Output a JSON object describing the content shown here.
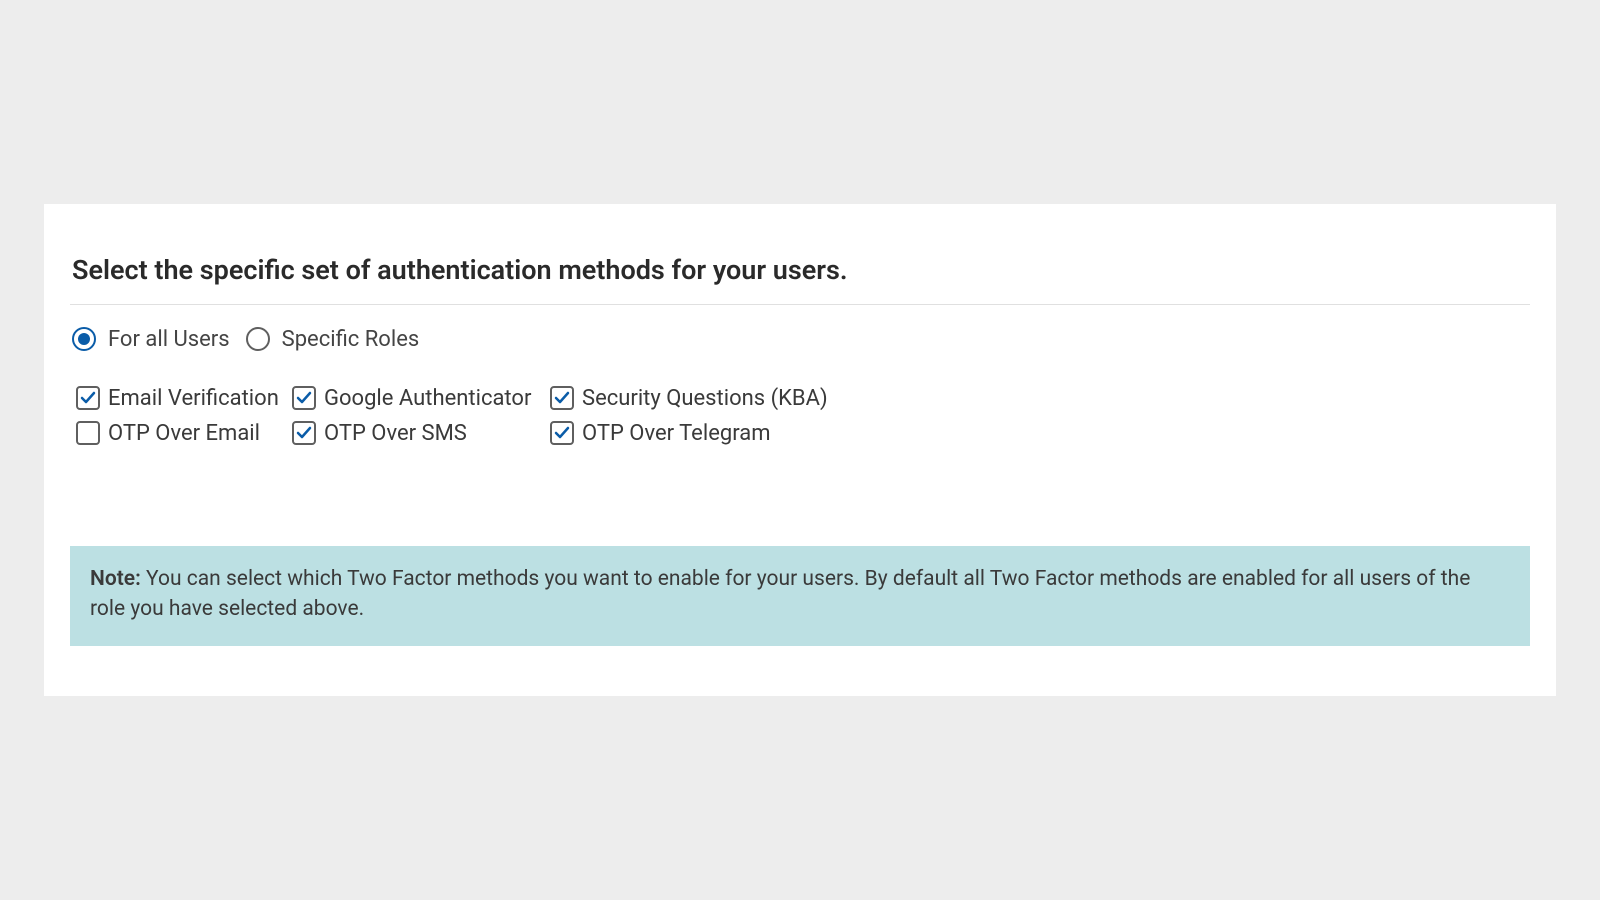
{
  "heading": "Select the specific set of authentication methods for your users.",
  "scope": {
    "options": [
      {
        "label": "For all Users",
        "selected": true
      },
      {
        "label": "Specific Roles",
        "selected": false
      }
    ]
  },
  "methods": {
    "rows": [
      [
        {
          "label": "Email Verification",
          "checked": true
        },
        {
          "label": "Google Authenticator",
          "checked": true
        },
        {
          "label": "Security Questions (KBA)",
          "checked": true
        }
      ],
      [
        {
          "label": "OTP Over Email",
          "checked": false
        },
        {
          "label": "OTP Over SMS",
          "checked": true
        },
        {
          "label": "OTP Over Telegram",
          "checked": true
        }
      ]
    ]
  },
  "note": {
    "prefix": "Note:",
    "text": " You can select which Two Factor methods you want to enable for your users. By default all Two Factor methods are enabled for all users of the role you have selected above."
  }
}
